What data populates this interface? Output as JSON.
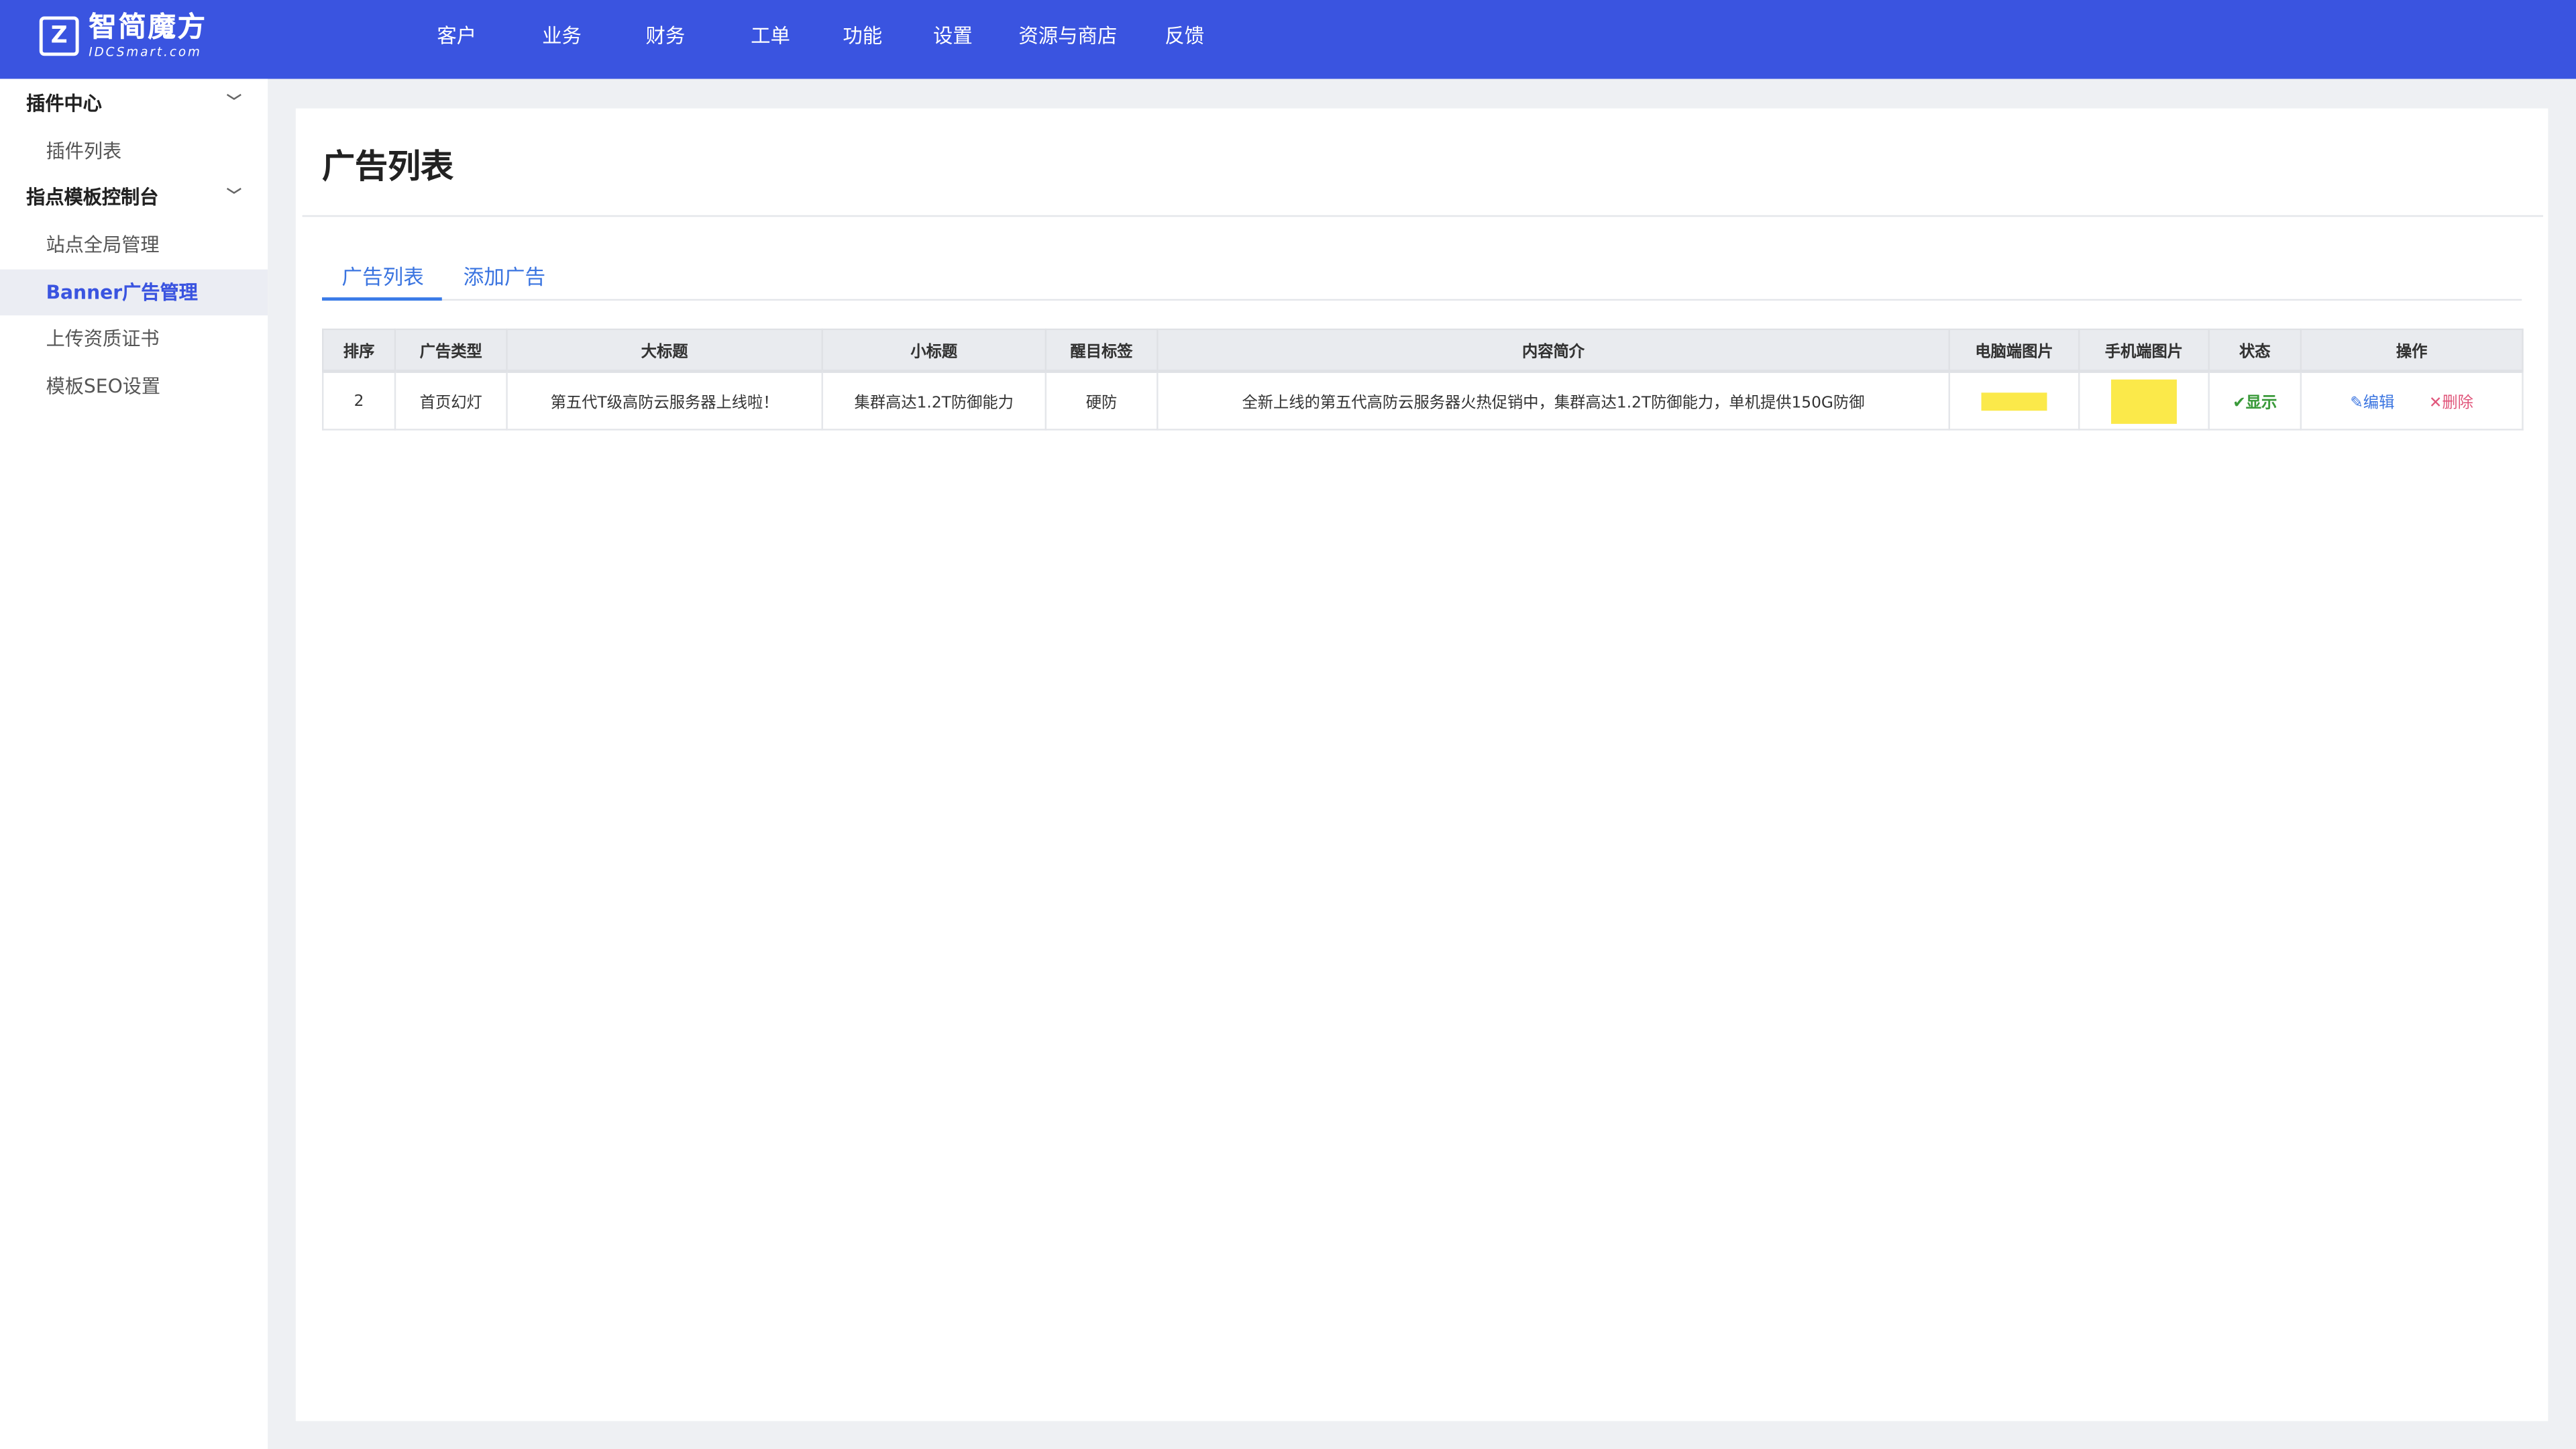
{
  "brand": {
    "name_cn": "智简魔方",
    "name_en": "IDCSmart.com",
    "primary_color": "#3a54e0"
  },
  "nav": [
    "客户",
    "业务",
    "财务",
    "工单",
    "功能",
    "设置",
    "资源与商店",
    "反馈"
  ],
  "sidebar": {
    "groups": [
      {
        "label": "插件中心",
        "items": [
          "插件列表"
        ]
      },
      {
        "label": "指点模板控制台",
        "items": [
          "站点全局管理",
          "Banner广告管理",
          "上传资质证书",
          "模板SEO设置"
        ]
      }
    ],
    "active": "Banner广告管理"
  },
  "page": {
    "title": "广告列表",
    "tabs": [
      "广告列表",
      "添加广告"
    ],
    "active_tab": "广告列表"
  },
  "table": {
    "columns": [
      "排序",
      "广告类型",
      "大标题",
      "小标题",
      "醒目标签",
      "内容简介",
      "电脑端图片",
      "手机端图片",
      "状态",
      "操作"
    ],
    "rows": [
      {
        "order": "2",
        "type": "首页幻灯",
        "title": "第五代T级高防云服务器上线啦！",
        "subtitle": "集群高达1.2T防御能力",
        "tag": "硬防",
        "summary": "全新上线的第五代高防云服务器火热促销中，集群高达1.2T防御能力，单机提供150G防御",
        "status": "显示",
        "edit": "编辑",
        "delete": "删除"
      }
    ]
  }
}
